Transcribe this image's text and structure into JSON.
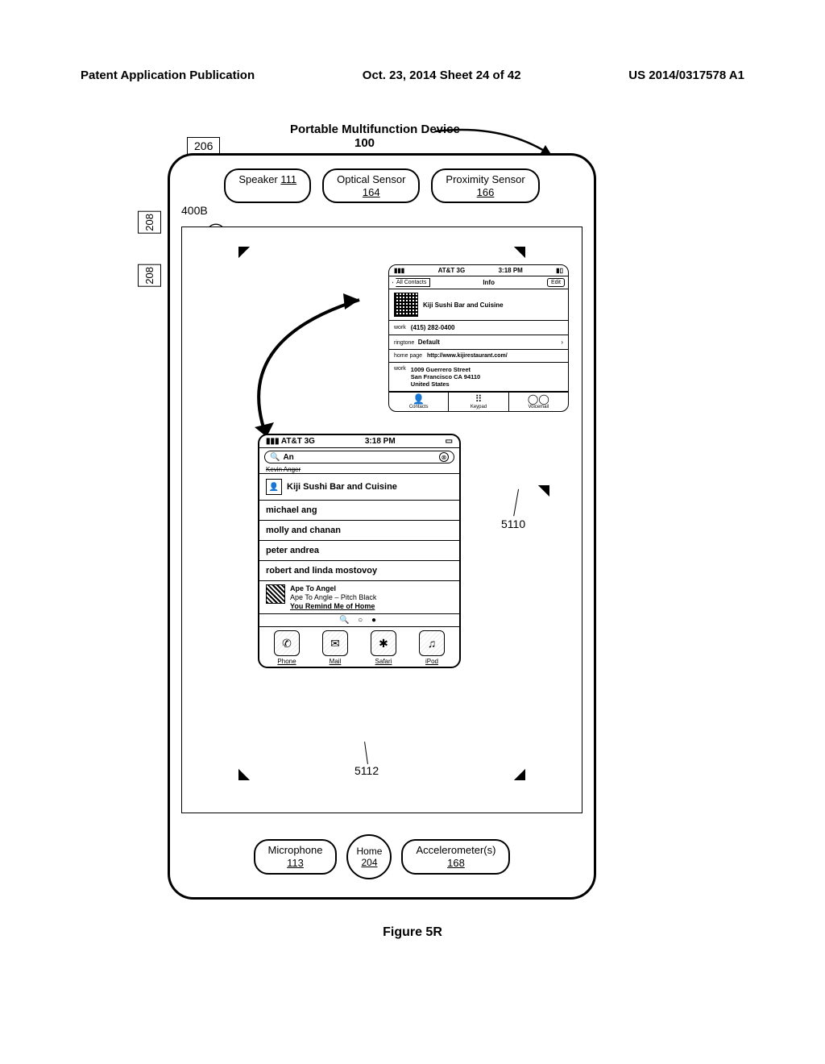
{
  "page_header": {
    "left": "Patent Application Publication",
    "center": "Oct. 23, 2014  Sheet 24 of 42",
    "right": "US 2014/0317578 A1"
  },
  "device_title": "Portable Multifunction Device",
  "device_ref": "100",
  "refs": {
    "r206": "206",
    "r208": "208",
    "r400b": "400B",
    "r5110": "5110",
    "r5112": "5112"
  },
  "sensors": {
    "speaker": {
      "label": "Speaker",
      "num": "111"
    },
    "optical": {
      "label": "Optical Sensor",
      "num": "164"
    },
    "proximity": {
      "label": "Proximity Sensor",
      "num": "166"
    }
  },
  "bottom": {
    "microphone": {
      "label": "Microphone",
      "num": "113"
    },
    "home": {
      "label": "Home",
      "num": "204"
    },
    "accel": {
      "label": "Accelerometer(s)",
      "num": "168"
    }
  },
  "status": {
    "carrier": "AT&T 3G",
    "time": "3:18 PM"
  },
  "info_card": {
    "back_btn": "All Contacts",
    "title": "Info",
    "edit": "Edit",
    "name": "Kiji Sushi Bar and Cuisine",
    "work_phone_label": "work",
    "work_phone": "(415) 282-0400",
    "ringtone_label": "ringtone",
    "ringtone": "Default",
    "homepage_label": "home page",
    "homepage": "http://www.kijirestaurant.com/",
    "addr_label": "work",
    "addr_line1": "1009 Guerrero Street",
    "addr_line2": "San Francisco CA 94110",
    "addr_line3": "United States",
    "tabs": [
      {
        "icon": "👤",
        "label": "Contacts"
      },
      {
        "icon": "⠿",
        "label": "Keypad"
      },
      {
        "icon": "◯◯",
        "label": "Voicemail"
      }
    ]
  },
  "search_card": {
    "query": "An",
    "prev": "Kevin Anger",
    "items": [
      "Kiji Sushi Bar and Cuisine",
      "michael ang",
      "molly and chanan",
      "peter andrea",
      "robert and linda mostovoy"
    ],
    "media": {
      "title": "Ape To Angel",
      "subtitle": "Ape To Angle  –  Pitch Black",
      "line3": "You Remind Me of Home"
    },
    "dock": [
      {
        "icon": "✆",
        "label": "Phone"
      },
      {
        "icon": "✉",
        "label": "Mail"
      },
      {
        "icon": "✱",
        "label": "Safari"
      },
      {
        "icon": "♫",
        "label": "iPod"
      }
    ]
  },
  "figure_label": "Figure 5R"
}
